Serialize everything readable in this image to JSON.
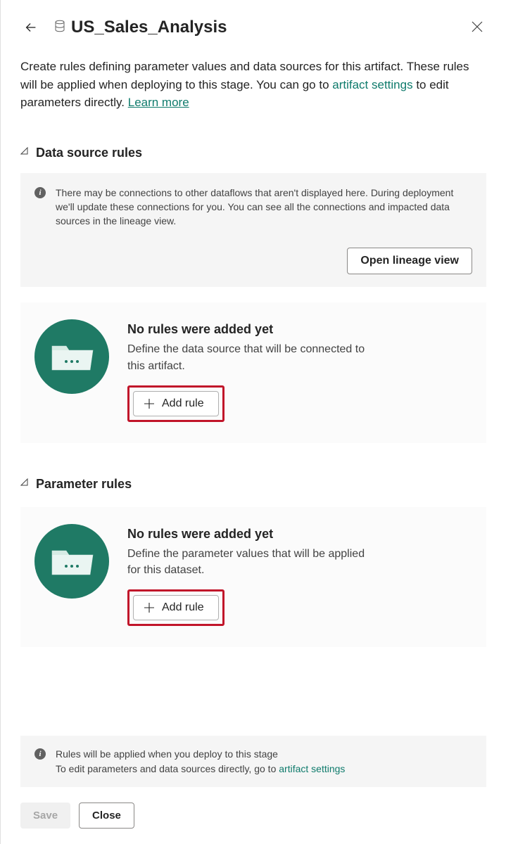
{
  "header": {
    "title": "US_Sales_Analysis"
  },
  "description": {
    "line1": "Create rules defining parameter values and data sources for this artifact. These rules will be applied when deploying to this stage. You can go to ",
    "artifact_link": "artifact settings",
    "line2": " to edit parameters directly. ",
    "learn_more": "Learn more"
  },
  "data_source": {
    "title": "Data source rules",
    "info": "There may be connections to other dataflows that aren't displayed here. During deployment we'll update these connections for you. You can see all the connections and impacted data sources in the lineage view.",
    "lineage_btn": "Open lineage view",
    "empty_title": "No rules were added yet",
    "empty_desc": "Define the data source that will be connected to this artifact.",
    "add_rule": "Add rule"
  },
  "parameter": {
    "title": "Parameter rules",
    "empty_title": "No rules were added yet",
    "empty_desc": "Define the parameter values that will be applied for this dataset.",
    "add_rule": "Add rule"
  },
  "bottom_info": {
    "line1": "Rules will be applied when you deploy to this stage",
    "line2": "To edit parameters and data sources directly, go to ",
    "artifact_link": "artifact settings"
  },
  "footer": {
    "save": "Save",
    "close": "Close"
  }
}
